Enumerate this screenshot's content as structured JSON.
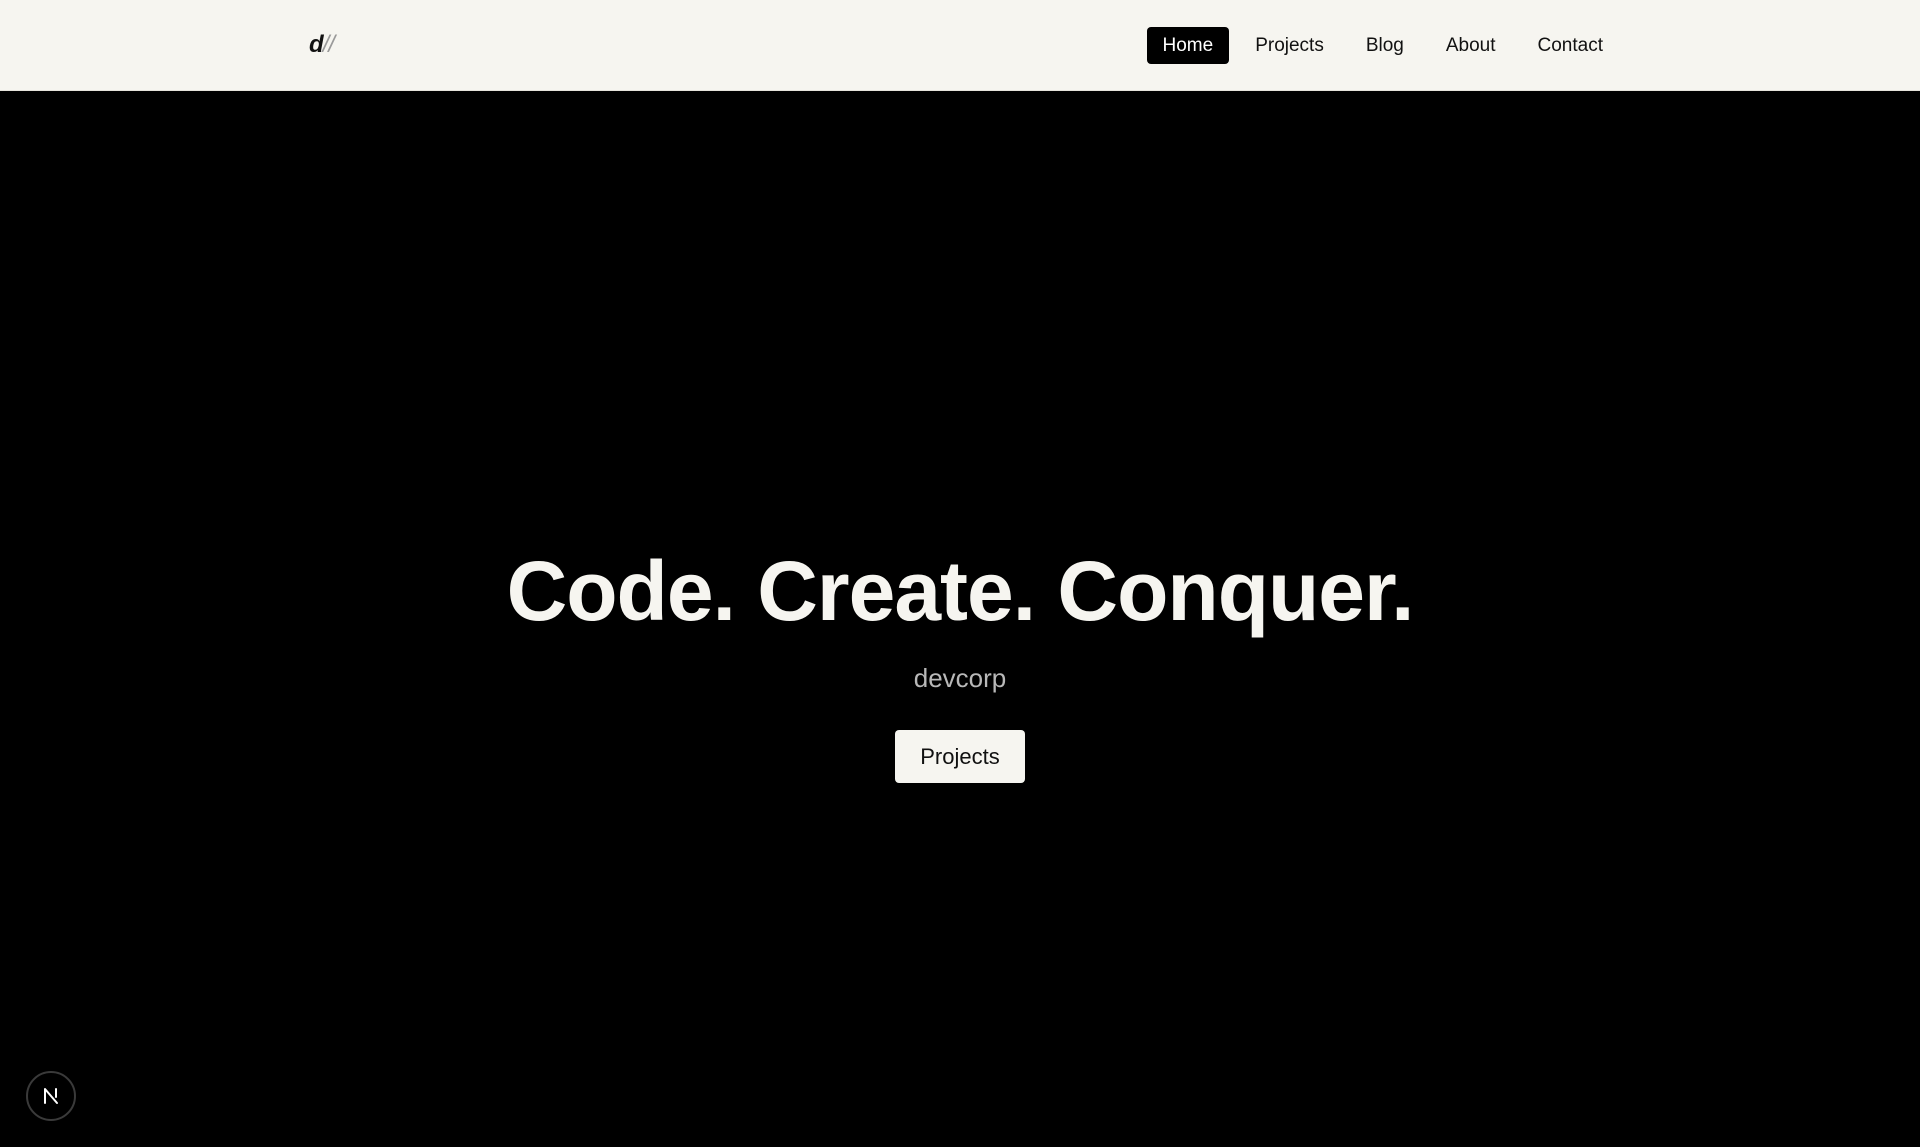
{
  "header": {
    "logo": {
      "mark": "d",
      "slashes": "//"
    },
    "nav": {
      "items": [
        {
          "label": "Home",
          "active": true
        },
        {
          "label": "Projects",
          "active": false
        },
        {
          "label": "Blog",
          "active": false
        },
        {
          "label": "About",
          "active": false
        },
        {
          "label": "Contact",
          "active": false
        }
      ]
    }
  },
  "hero": {
    "title": "Code. Create. Conquer.",
    "subtitle": "devcorp",
    "cta_label": "Projects"
  },
  "dev_badge": {
    "icon": "nextjs-n-icon"
  },
  "colors": {
    "header_bg": "#f6f5f0",
    "hero_bg": "#000000",
    "hero_text": "#f6f5f0",
    "subtitle_text": "#b8b8b8",
    "active_nav_bg": "#000000"
  }
}
